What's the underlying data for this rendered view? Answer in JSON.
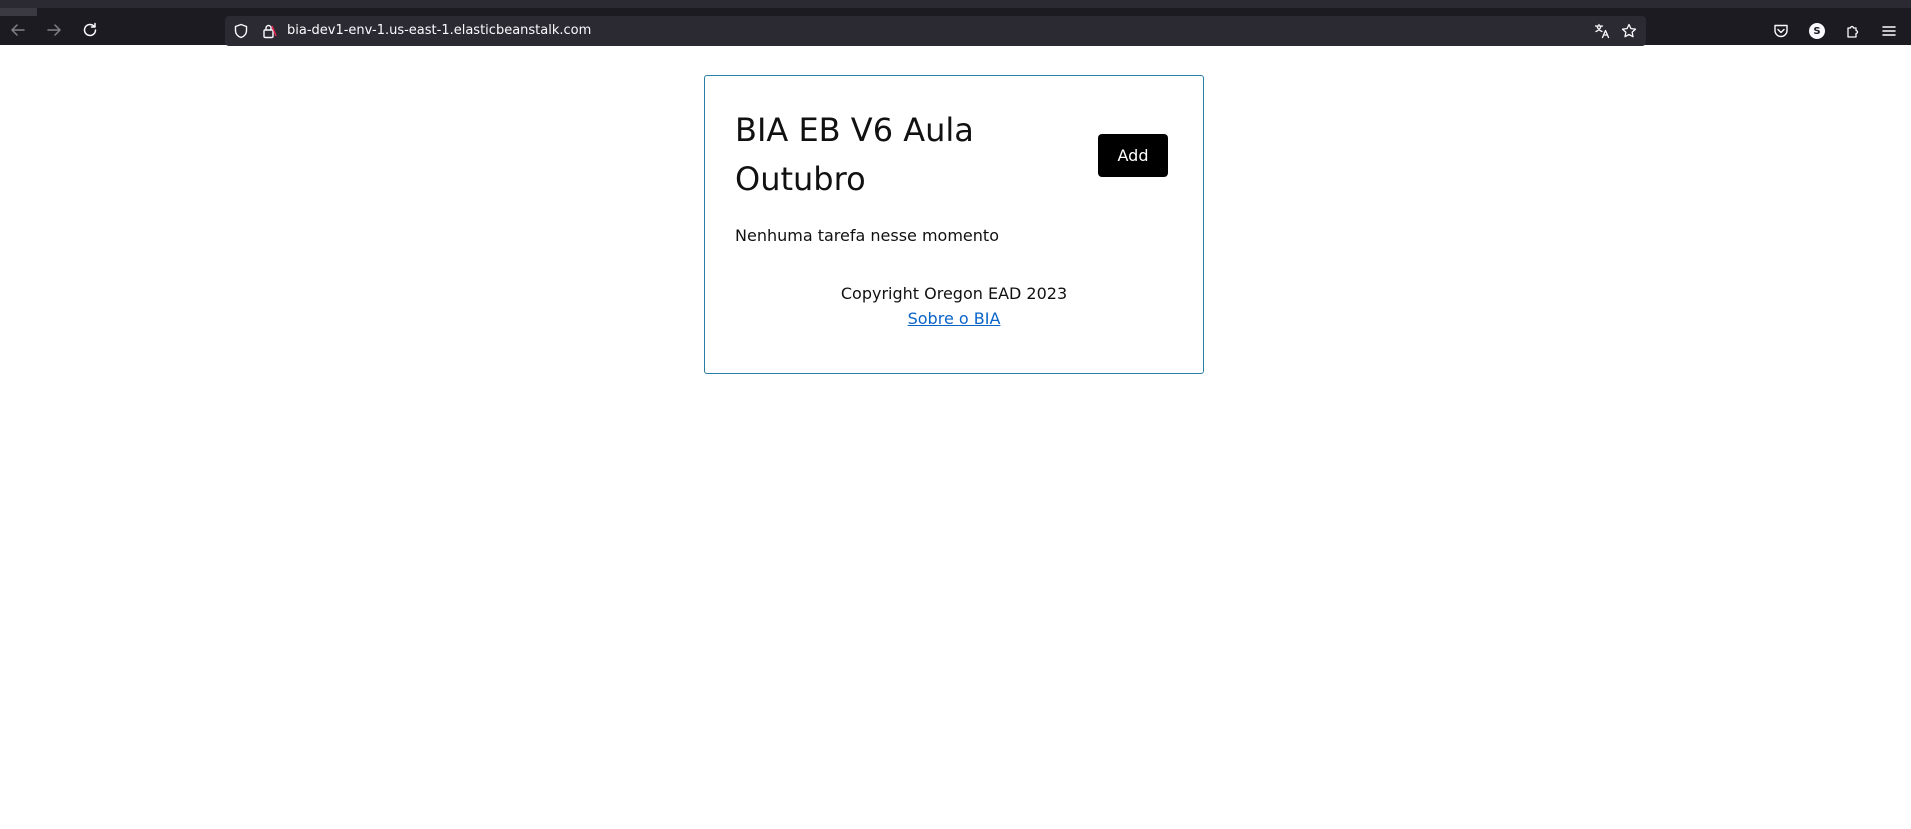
{
  "browser": {
    "url": "bia-dev1-env-1.us-east-1.elasticbeanstalk.com",
    "account_initial": "S",
    "icons": {
      "back": "arrow-left-icon",
      "forward": "arrow-right-icon",
      "reload": "reload-icon",
      "tracking": "shield-icon",
      "security": "lock-icon",
      "translate": "translate-icon",
      "bookmark": "star-icon",
      "pocket": "pocket-icon",
      "account": "account-icon",
      "extensions": "puzzle-icon",
      "menu": "hamburger-menu-icon"
    }
  },
  "app": {
    "title": "BIA EB V6 Aula Outubro",
    "add_label": "Add",
    "empty_message": "Nenhuma tarefa nesse momento",
    "copyright": "Copyright Oregon EAD 2023",
    "about_link": "Sobre o BIA"
  },
  "colors": {
    "browser_bg": "#1c1b22",
    "urlbar_bg": "#2b2a33",
    "card_border": "#2a7fa8",
    "button_bg": "#000000",
    "link": "#0a64c8"
  }
}
